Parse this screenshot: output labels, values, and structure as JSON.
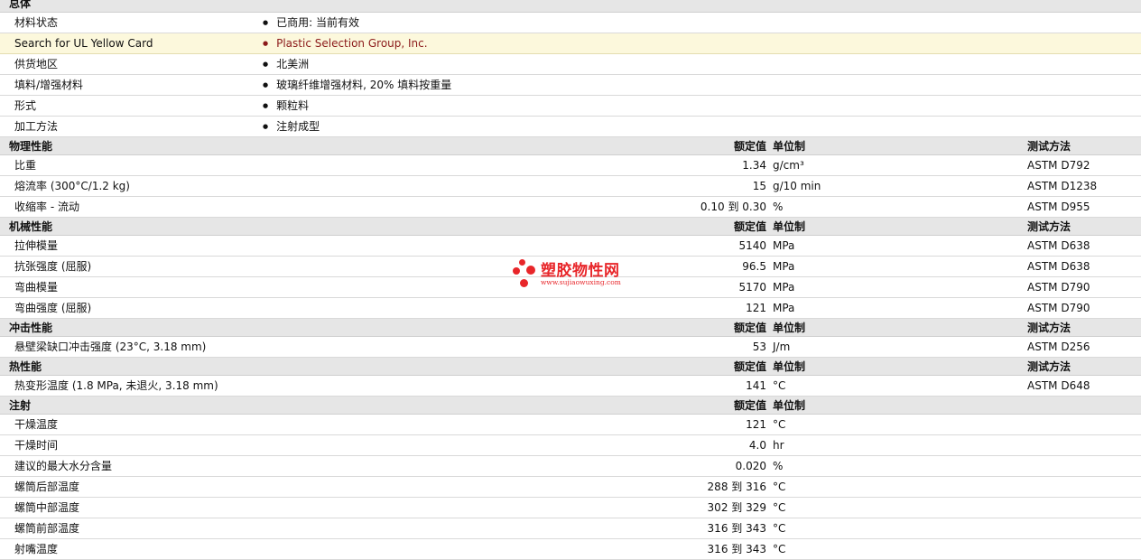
{
  "general": {
    "title": "总体",
    "rows": [
      {
        "label": "材料状态",
        "value": "已商用: 当前有效"
      },
      {
        "label": "Search for UL Yellow Card",
        "value": "Plastic Selection Group, Inc."
      },
      {
        "label": "供货地区",
        "value": "北美洲"
      },
      {
        "label": "填料/增强材料",
        "value": "玻璃纤维增强材料, 20% 填料按重量"
      },
      {
        "label": "形式",
        "value": "颗粒料"
      },
      {
        "label": "加工方法",
        "value": "注射成型"
      }
    ]
  },
  "headers": {
    "nominal": "额定值",
    "unit": "单位制",
    "test": "测试方法"
  },
  "physical": {
    "title": "物理性能",
    "rows": [
      {
        "label": "比重",
        "value": "1.34",
        "unit": "g/cm³",
        "test": "ASTM D792"
      },
      {
        "label": "熔流率 (300°C/1.2 kg)",
        "value": "15",
        "unit": "g/10 min",
        "test": "ASTM D1238"
      },
      {
        "label": "收缩率 - 流动",
        "value": "0.10 到 0.30",
        "unit": "%",
        "test": "ASTM D955"
      }
    ]
  },
  "mechanical": {
    "title": "机械性能",
    "rows": [
      {
        "label": "拉伸模量",
        "value": "5140",
        "unit": "MPa",
        "test": "ASTM D638"
      },
      {
        "label": "抗张强度 (屈服)",
        "value": "96.5",
        "unit": "MPa",
        "test": "ASTM D638"
      },
      {
        "label": "弯曲模量",
        "value": "5170",
        "unit": "MPa",
        "test": "ASTM D790"
      },
      {
        "label": "弯曲强度 (屈服)",
        "value": "121",
        "unit": "MPa",
        "test": "ASTM D790"
      }
    ]
  },
  "impact": {
    "title": "冲击性能",
    "rows": [
      {
        "label": "悬壁梁缺口冲击强度 (23°C, 3.18 mm)",
        "value": "53",
        "unit": "J/m",
        "test": "ASTM D256"
      }
    ]
  },
  "thermal": {
    "title": "热性能",
    "rows": [
      {
        "label": "热变形温度 (1.8 MPa, 未退火, 3.18 mm)",
        "value": "141",
        "unit": "°C",
        "test": "ASTM D648"
      }
    ]
  },
  "injection": {
    "title": "注射",
    "rows": [
      {
        "label": "干燥温度",
        "value": "121",
        "unit": "°C"
      },
      {
        "label": "干燥时间",
        "value": "4.0",
        "unit": "hr"
      },
      {
        "label": "建议的最大水分含量",
        "value": "0.020",
        "unit": "%"
      },
      {
        "label": "螺筒后部温度",
        "value": "288 到 316",
        "unit": "°C"
      },
      {
        "label": "螺筒中部温度",
        "value": "302 到 329",
        "unit": "°C"
      },
      {
        "label": "螺筒前部温度",
        "value": "316 到 343",
        "unit": "°C"
      },
      {
        "label": "射嘴温度",
        "value": "316 到 343",
        "unit": "°C"
      }
    ]
  },
  "watermark": {
    "title": "塑胶物性网",
    "url": "www.sujiaowuxing.com",
    "color": "#e8262a"
  }
}
